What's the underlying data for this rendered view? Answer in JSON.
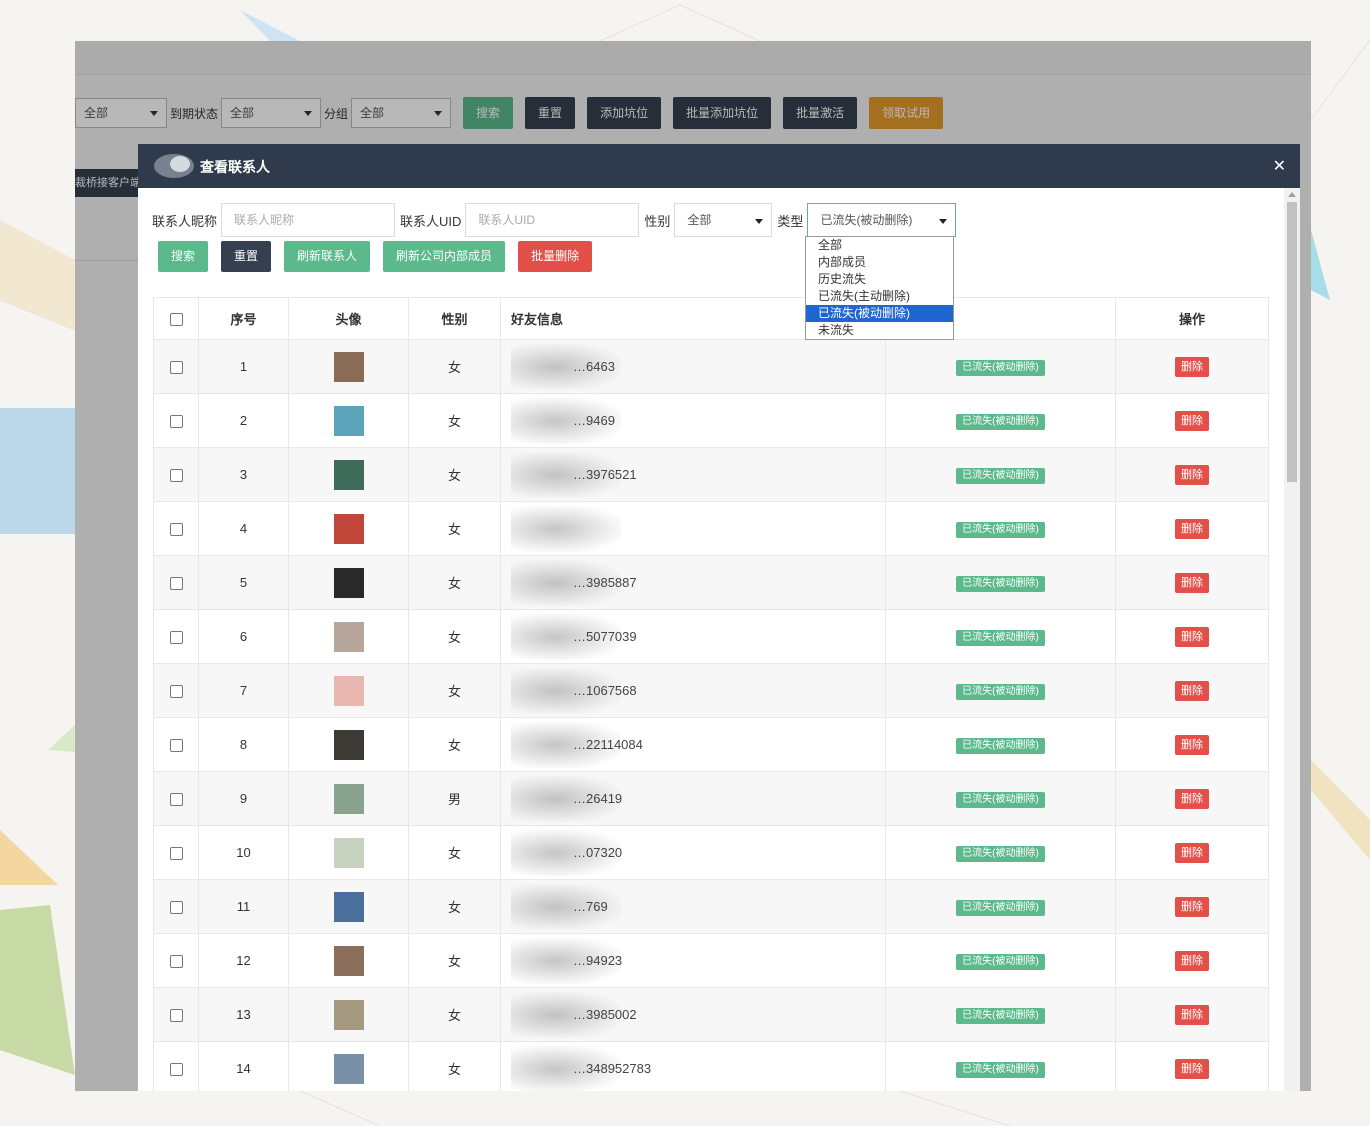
{
  "colors": {
    "modal_header": "#2f3b4d",
    "btn_green": "#5bb98c",
    "btn_dark": "#34404f",
    "btn_red": "#e3504a",
    "btn_orange": "#e39a2c"
  },
  "app": {
    "filters": {
      "first_select": "全部",
      "expire_label": "到期状态",
      "expire_select": "全部",
      "group_label": "分组",
      "group_select": "全部"
    },
    "buttons": {
      "search": "搜索",
      "reset": "重置",
      "add_slot": "添加坑位",
      "batch_add_slot": "批量添加坑位",
      "batch_activate": "批量激活",
      "claim_trial": "领取试用"
    },
    "side_text": "裁桥接客户端"
  },
  "modal": {
    "title": "查看联系人",
    "close_icon": "close-icon",
    "filters": {
      "nickname_label": "联系人昵称",
      "nickname_placeholder": "联系人昵称",
      "uid_label": "联系人UID",
      "uid_placeholder": "联系人UID",
      "gender_label": "性别",
      "gender_value": "全部",
      "type_label": "类型",
      "type_value": "已流失(被动删除)"
    },
    "type_options": [
      "全部",
      "内部成员",
      "历史流失",
      "已流失(主动删除)",
      "已流失(被动删除)",
      "未流失"
    ],
    "buttons": {
      "search": "搜索",
      "reset": "重置",
      "refresh_contacts": "刷新联系人",
      "refresh_internal": "刷新公司内部成员",
      "batch_delete": "批量删除"
    },
    "table": {
      "headers": {
        "index": "序号",
        "avatar": "头像",
        "gender": "性别",
        "info": "好友信息",
        "action": "操作"
      },
      "status_label": "已流失(被动删除)",
      "delete_label": "删除",
      "rows": [
        {
          "index": "1",
          "gender": "女",
          "info": "…6463"
        },
        {
          "index": "2",
          "gender": "女",
          "info": "…9469"
        },
        {
          "index": "3",
          "gender": "女",
          "info": "…3976521"
        },
        {
          "index": "4",
          "gender": "女",
          "info": ""
        },
        {
          "index": "5",
          "gender": "女",
          "info": "…3985887"
        },
        {
          "index": "6",
          "gender": "女",
          "info": "…5077039"
        },
        {
          "index": "7",
          "gender": "女",
          "info": "…1067568"
        },
        {
          "index": "8",
          "gender": "女",
          "info": "…22114084"
        },
        {
          "index": "9",
          "gender": "男",
          "info": "…26419"
        },
        {
          "index": "10",
          "gender": "女",
          "info": "…07320"
        },
        {
          "index": "11",
          "gender": "女",
          "info": "…769"
        },
        {
          "index": "12",
          "gender": "女",
          "info": "…94923"
        },
        {
          "index": "13",
          "gender": "女",
          "info": "…3985002"
        },
        {
          "index": "14",
          "gender": "女",
          "info": "…348952783"
        }
      ]
    }
  }
}
